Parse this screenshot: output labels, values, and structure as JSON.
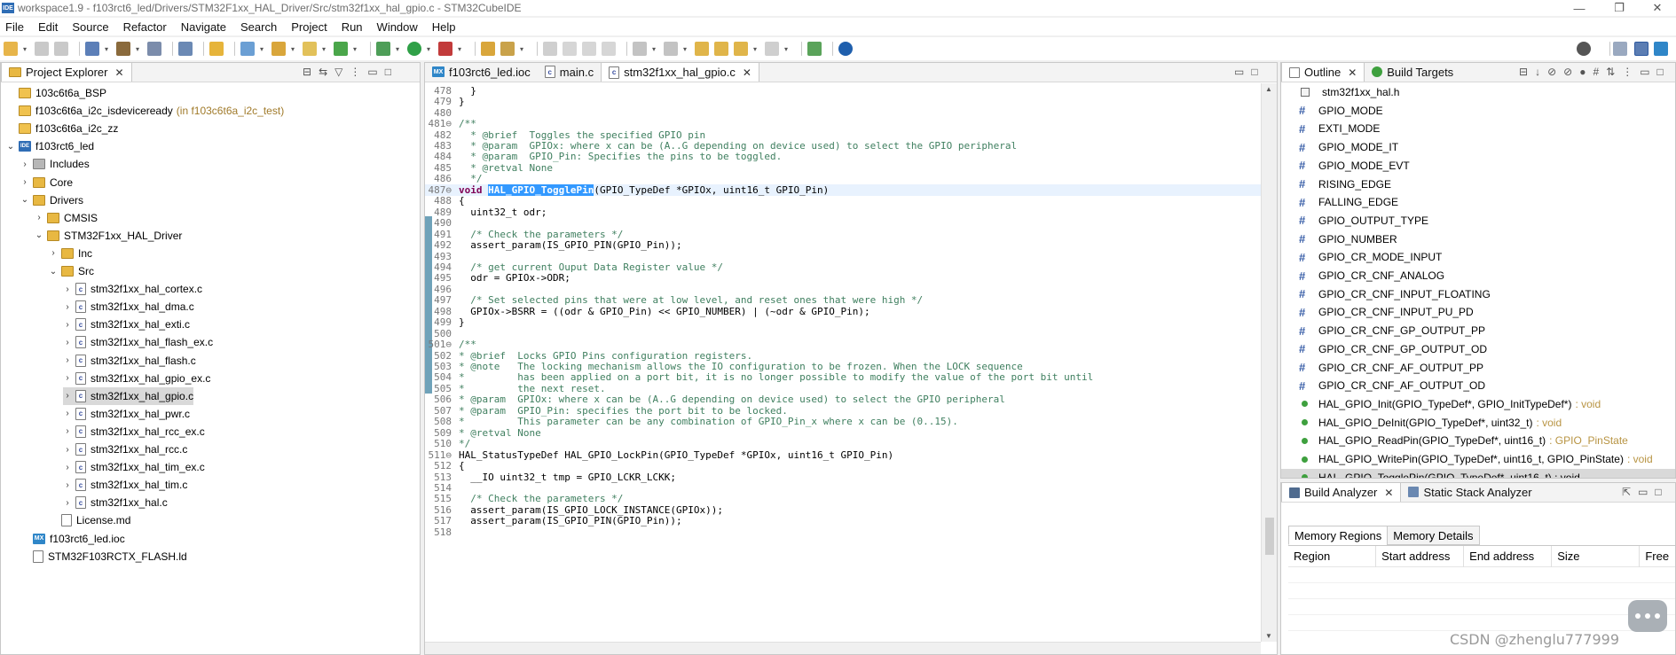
{
  "window": {
    "badge": "IDE",
    "title": "workspace1.9 - f103rct6_led/Drivers/STM32F1xx_HAL_Driver/Src/stm32f1xx_hal_gpio.c - STM32CubeIDE",
    "minimize_glyph": "—",
    "restore_glyph": "❐",
    "close_glyph": "✕"
  },
  "menu": [
    "File",
    "Edit",
    "Source",
    "Refactor",
    "Navigate",
    "Search",
    "Project",
    "Run",
    "Window",
    "Help"
  ],
  "project_explorer": {
    "tab_label": "Project Explorer",
    "items": [
      {
        "label": "103c6t6a_BSP",
        "note": "",
        "icon": "project-folder-icon",
        "twist": "",
        "depth": 0
      },
      {
        "label": "f103c6t6a_i2c_isdeviceready",
        "note": "(in f103c6t6a_i2c_test)",
        "icon": "project-folder-icon",
        "twist": "",
        "depth": 0
      },
      {
        "label": "f103c6t6a_i2c_zz",
        "note": "",
        "icon": "project-folder-icon",
        "twist": "",
        "depth": 0
      },
      {
        "label": "f103rct6_led",
        "note": "",
        "icon": "ide-project-icon",
        "twist": "v",
        "depth": 0
      },
      {
        "label": "Includes",
        "note": "",
        "icon": "includes-icon",
        "twist": ">",
        "depth": 1
      },
      {
        "label": "Core",
        "note": "",
        "icon": "folder-icon",
        "twist": ">",
        "depth": 1
      },
      {
        "label": "Drivers",
        "note": "",
        "icon": "folder-icon",
        "twist": "v",
        "depth": 1
      },
      {
        "label": "CMSIS",
        "note": "",
        "icon": "folder-icon",
        "twist": ">",
        "depth": 2
      },
      {
        "label": "STM32F1xx_HAL_Driver",
        "note": "",
        "icon": "folder-icon",
        "twist": "v",
        "depth": 2
      },
      {
        "label": "Inc",
        "note": "",
        "icon": "folder-icon",
        "twist": ">",
        "depth": 3
      },
      {
        "label": "Src",
        "note": "",
        "icon": "folder-icon",
        "twist": "v",
        "depth": 3
      },
      {
        "label": "stm32f1xx_hal_cortex.c",
        "note": "",
        "icon": "c-file-icon",
        "twist": ">",
        "depth": 4
      },
      {
        "label": "stm32f1xx_hal_dma.c",
        "note": "",
        "icon": "c-file-icon",
        "twist": ">",
        "depth": 4
      },
      {
        "label": "stm32f1xx_hal_exti.c",
        "note": "",
        "icon": "c-file-icon",
        "twist": ">",
        "depth": 4
      },
      {
        "label": "stm32f1xx_hal_flash_ex.c",
        "note": "",
        "icon": "c-file-icon",
        "twist": ">",
        "depth": 4
      },
      {
        "label": "stm32f1xx_hal_flash.c",
        "note": "",
        "icon": "c-file-icon",
        "twist": ">",
        "depth": 4
      },
      {
        "label": "stm32f1xx_hal_gpio_ex.c",
        "note": "",
        "icon": "c-file-icon",
        "twist": ">",
        "depth": 4
      },
      {
        "label": "stm32f1xx_hal_gpio.c",
        "note": "",
        "icon": "c-file-icon",
        "twist": ">",
        "depth": 4,
        "selected": true
      },
      {
        "label": "stm32f1xx_hal_pwr.c",
        "note": "",
        "icon": "c-file-icon",
        "twist": ">",
        "depth": 4
      },
      {
        "label": "stm32f1xx_hal_rcc_ex.c",
        "note": "",
        "icon": "c-file-icon",
        "twist": ">",
        "depth": 4
      },
      {
        "label": "stm32f1xx_hal_rcc.c",
        "note": "",
        "icon": "c-file-icon",
        "twist": ">",
        "depth": 4
      },
      {
        "label": "stm32f1xx_hal_tim_ex.c",
        "note": "",
        "icon": "c-file-icon",
        "twist": ">",
        "depth": 4
      },
      {
        "label": "stm32f1xx_hal_tim.c",
        "note": "",
        "icon": "c-file-icon",
        "twist": ">",
        "depth": 4
      },
      {
        "label": "stm32f1xx_hal.c",
        "note": "",
        "icon": "c-file-icon",
        "twist": ">",
        "depth": 4
      },
      {
        "label": "License.md",
        "note": "",
        "icon": "file-icon",
        "twist": "",
        "depth": 3
      },
      {
        "label": "f103rct6_led.ioc",
        "note": "",
        "icon": "mx-file-icon",
        "twist": "",
        "depth": 1
      },
      {
        "label": "STM32F103RCTX_FLASH.ld",
        "note": "",
        "icon": "file-icon",
        "twist": "",
        "depth": 1
      }
    ]
  },
  "editor": {
    "tabs": [
      {
        "label": "f103rct6_led.ioc",
        "icon": "mx-file-icon",
        "active": false
      },
      {
        "label": "main.c",
        "icon": "c-file-icon",
        "active": false
      },
      {
        "label": "stm32f1xx_hal_gpio.c",
        "icon": "c-file-icon",
        "active": true
      }
    ],
    "lines": [
      {
        "n": "478",
        "t": "  }",
        "c": "code"
      },
      {
        "n": "479",
        "t": "}",
        "c": "code"
      },
      {
        "n": "480",
        "t": "",
        "c": "code"
      },
      {
        "n": "481⊖",
        "t": "/**",
        "c": "comment"
      },
      {
        "n": "482",
        "t": "  * @brief  Toggles the specified GPIO pin",
        "c": "comment"
      },
      {
        "n": "483",
        "t": "  * @param  GPIOx: where x can be (A..G depending on device used) to select the GPIO peripheral",
        "c": "comment"
      },
      {
        "n": "484",
        "t": "  * @param  GPIO_Pin: Specifies the pins to be toggled.",
        "c": "comment"
      },
      {
        "n": "485",
        "t": "  * @retval None",
        "c": "comment"
      },
      {
        "n": "486",
        "t": "  */",
        "c": "comment"
      },
      {
        "n": "487⊖",
        "t": "(GPIO_TypeDef *GPIOx, uint16_t GPIO_Pin)",
        "c": "hl",
        "kw": "void ",
        "sel": "HAL_GPIO_TogglePin"
      },
      {
        "n": "488",
        "t": "{",
        "c": "code"
      },
      {
        "n": "489",
        "t": "  uint32_t odr;",
        "c": "code"
      },
      {
        "n": "490",
        "t": "",
        "c": "code"
      },
      {
        "n": "491",
        "t": "  /* Check the parameters */",
        "c": "comment"
      },
      {
        "n": "492",
        "t": "  assert_param(IS_GPIO_PIN(GPIO_Pin));",
        "c": "code"
      },
      {
        "n": "493",
        "t": "",
        "c": "code"
      },
      {
        "n": "494",
        "t": "  /* get current Ouput Data Register value */",
        "c": "comment"
      },
      {
        "n": "495",
        "t": "  odr = GPIOx->ODR;",
        "c": "code"
      },
      {
        "n": "496",
        "t": "",
        "c": "code"
      },
      {
        "n": "497",
        "t": "  /* Set selected pins that were at low level, and reset ones that were high */",
        "c": "comment"
      },
      {
        "n": "498",
        "t": "  GPIOx->BSRR = ((odr & GPIO_Pin) << GPIO_NUMBER) | (~odr & GPIO_Pin);",
        "c": "code"
      },
      {
        "n": "499",
        "t": "}",
        "c": "code"
      },
      {
        "n": "500",
        "t": "",
        "c": "code"
      },
      {
        "n": "501⊖",
        "t": "/**",
        "c": "comment"
      },
      {
        "n": "502",
        "t": "* @brief  Locks GPIO Pins configuration registers.",
        "c": "comment"
      },
      {
        "n": "503",
        "t": "* @note   The locking mechanism allows the IO configuration to be frozen. When the LOCK sequence",
        "c": "comment"
      },
      {
        "n": "504",
        "t": "*         has been applied on a port bit, it is no longer possible to modify the value of the port bit until",
        "c": "comment"
      },
      {
        "n": "505",
        "t": "*         the next reset.",
        "c": "comment"
      },
      {
        "n": "506",
        "t": "* @param  GPIOx: where x can be (A..G depending on device used) to select the GPIO peripheral",
        "c": "comment"
      },
      {
        "n": "507",
        "t": "* @param  GPIO_Pin: specifies the port bit to be locked.",
        "c": "comment"
      },
      {
        "n": "508",
        "t": "*         This parameter can be any combination of GPIO_Pin_x where x can be (0..15).",
        "c": "comment"
      },
      {
        "n": "509",
        "t": "* @retval None",
        "c": "comment"
      },
      {
        "n": "510",
        "t": "*/",
        "c": "comment"
      },
      {
        "n": "511⊖",
        "t": "HAL_StatusTypeDef HAL_GPIO_LockPin(GPIO_TypeDef *GPIOx, uint16_t GPIO_Pin)",
        "c": "code"
      },
      {
        "n": "512",
        "t": "{",
        "c": "code"
      },
      {
        "n": "513",
        "t": "  __IO uint32_t tmp = GPIO_LCKR_LCKK;",
        "c": "code"
      },
      {
        "n": "514",
        "t": "",
        "c": "code"
      },
      {
        "n": "515",
        "t": "  /* Check the parameters */",
        "c": "comment"
      },
      {
        "n": "516",
        "t": "  assert_param(IS_GPIO_LOCK_INSTANCE(GPIOx));",
        "c": "code"
      },
      {
        "n": "517",
        "t": "  assert_param(IS_GPIO_PIN(GPIO_Pin));",
        "c": "code"
      },
      {
        "n": "518",
        "t": "",
        "c": "code"
      }
    ]
  },
  "outline": {
    "tab_label": "Outline",
    "build_targets_label": "Build Targets",
    "items": [
      {
        "label": "stm32f1xx_hal.h",
        "kind": "include",
        "ret": ""
      },
      {
        "label": "GPIO_MODE",
        "kind": "macro",
        "ret": ""
      },
      {
        "label": "EXTI_MODE",
        "kind": "macro",
        "ret": ""
      },
      {
        "label": "GPIO_MODE_IT",
        "kind": "macro",
        "ret": ""
      },
      {
        "label": "GPIO_MODE_EVT",
        "kind": "macro",
        "ret": ""
      },
      {
        "label": "RISING_EDGE",
        "kind": "macro",
        "ret": ""
      },
      {
        "label": "FALLING_EDGE",
        "kind": "macro",
        "ret": ""
      },
      {
        "label": "GPIO_OUTPUT_TYPE",
        "kind": "macro",
        "ret": ""
      },
      {
        "label": "GPIO_NUMBER",
        "kind": "macro",
        "ret": ""
      },
      {
        "label": "GPIO_CR_MODE_INPUT",
        "kind": "macro",
        "ret": ""
      },
      {
        "label": "GPIO_CR_CNF_ANALOG",
        "kind": "macro",
        "ret": ""
      },
      {
        "label": "GPIO_CR_CNF_INPUT_FLOATING",
        "kind": "macro",
        "ret": ""
      },
      {
        "label": "GPIO_CR_CNF_INPUT_PU_PD",
        "kind": "macro",
        "ret": ""
      },
      {
        "label": "GPIO_CR_CNF_GP_OUTPUT_PP",
        "kind": "macro",
        "ret": ""
      },
      {
        "label": "GPIO_CR_CNF_GP_OUTPUT_OD",
        "kind": "macro",
        "ret": ""
      },
      {
        "label": "GPIO_CR_CNF_AF_OUTPUT_PP",
        "kind": "macro",
        "ret": ""
      },
      {
        "label": "GPIO_CR_CNF_AF_OUTPUT_OD",
        "kind": "macro",
        "ret": ""
      },
      {
        "label": "HAL_GPIO_Init(GPIO_TypeDef*, GPIO_InitTypeDef*)",
        "kind": "function",
        "ret": ": void"
      },
      {
        "label": "HAL_GPIO_DeInit(GPIO_TypeDef*, uint32_t)",
        "kind": "function",
        "ret": ": void"
      },
      {
        "label": "HAL_GPIO_ReadPin(GPIO_TypeDef*, uint16_t)",
        "kind": "function",
        "ret": ": GPIO_PinState"
      },
      {
        "label": "HAL_GPIO_WritePin(GPIO_TypeDef*, uint16_t, GPIO_PinState)",
        "kind": "function",
        "ret": ": void"
      },
      {
        "label": "HAL_GPIO_TogglePin(GPIO_TypeDef*, uint16_t) : void",
        "kind": "function",
        "ret": "",
        "selected": true
      }
    ]
  },
  "build_analyzer": {
    "tab_label": "Build Analyzer",
    "static_stack_label": "Static Stack Analyzer",
    "subtabs": [
      "Memory Regions",
      "Memory Details"
    ],
    "columns": [
      "Region",
      "Start address",
      "End address",
      "Size",
      "Free"
    ]
  },
  "watermark": "CSDN @zhenglu777999"
}
